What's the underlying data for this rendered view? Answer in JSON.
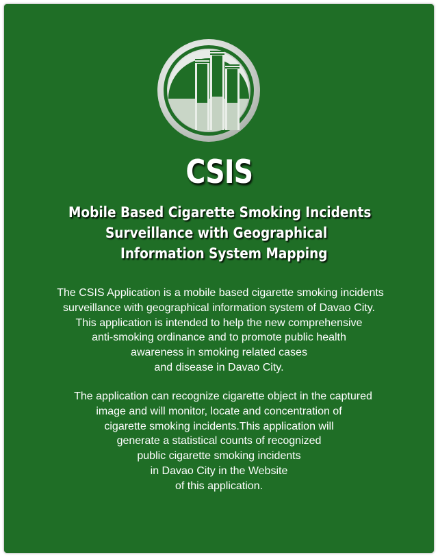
{
  "app": {
    "brand": "CSIS",
    "subtitle_lines": [
      "Mobile Based Cigarette Smoking Incidents",
      "Surveillance with Geographical",
      "Information System Mapping"
    ]
  },
  "description": {
    "paragraph1": [
      "The CSIS Application is a mobile based cigarette smoking incidents",
      "surveillance with geographical information system of Davao City.",
      "This application is intended to help the new comprehensive",
      "anti-smoking ordinance and to promote public health",
      "awareness in smoking related cases",
      "and disease in Davao City."
    ],
    "paragraph2": [
      "The application can recognize cigarette object in the captured",
      "image and will monitor, locate and concentration of",
      "cigarette smoking incidents.This application will",
      "generate a statistical counts of recognized",
      "public cigarette smoking incidents",
      "in Davao City in the Website",
      "of this application."
    ]
  },
  "colors": {
    "background": "#1f6e26",
    "text": "#ffffff",
    "logo_ring": "#d9ddd9",
    "logo_bars_light": "#c4d2c2"
  },
  "icons": {
    "logo": "bar-chart-logo-icon"
  }
}
